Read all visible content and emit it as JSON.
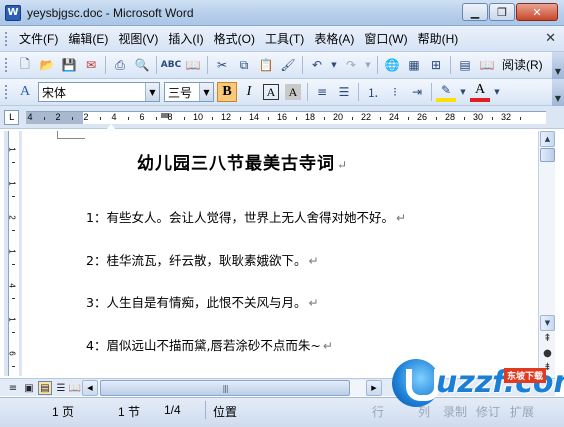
{
  "window": {
    "title": "yeysbjgsc.doc - Microsoft Word",
    "app_icon": "word-icon"
  },
  "menu": {
    "items": [
      "文件(F)",
      "编辑(E)",
      "视图(V)",
      "插入(I)",
      "格式(O)",
      "工具(T)",
      "表格(A)",
      "窗口(W)",
      "帮助(H)"
    ]
  },
  "toolbar": {
    "read_label": "阅读(R)"
  },
  "format_toolbar": {
    "style_icon": "styles-icon",
    "font_name": "宋体",
    "font_size": "三号",
    "bold_label": "B",
    "italic_label": "I",
    "char_border_label": "A",
    "char_shading_label": "A",
    "font_color_label": "A"
  },
  "ruler": {
    "numbers": [
      "4",
      "2",
      "2",
      "4",
      "6",
      "8",
      "10",
      "12",
      "14",
      "16",
      "18",
      "20",
      "22",
      "24",
      "26",
      "28",
      "30",
      "32"
    ]
  },
  "vruler": {
    "numbers": [
      "1",
      "1",
      "2",
      "1",
      "4",
      "1",
      "6"
    ]
  },
  "document": {
    "title": "幼儿园三八节最美古寺词",
    "lines": [
      "1：有些女人。会让人觉得，世界上无人舍得对她不好。",
      "2：桂华流瓦，纤云散，耿耿素娥欲下。",
      "3：人生自是有情痴，此恨不关风与月。",
      "4：眉似远山不描而黛,唇若涂砂不点而朱~"
    ],
    "paragraph_mark": "↵"
  },
  "statusbar": {
    "page": "1 页",
    "section": "1 节",
    "page_of": "1/4",
    "position_label": "位置",
    "modes": [
      "行",
      "列",
      "录制",
      "修订",
      "扩展"
    ]
  },
  "watermark": {
    "text": "uzzf.com",
    "badge": "东坡下载"
  }
}
